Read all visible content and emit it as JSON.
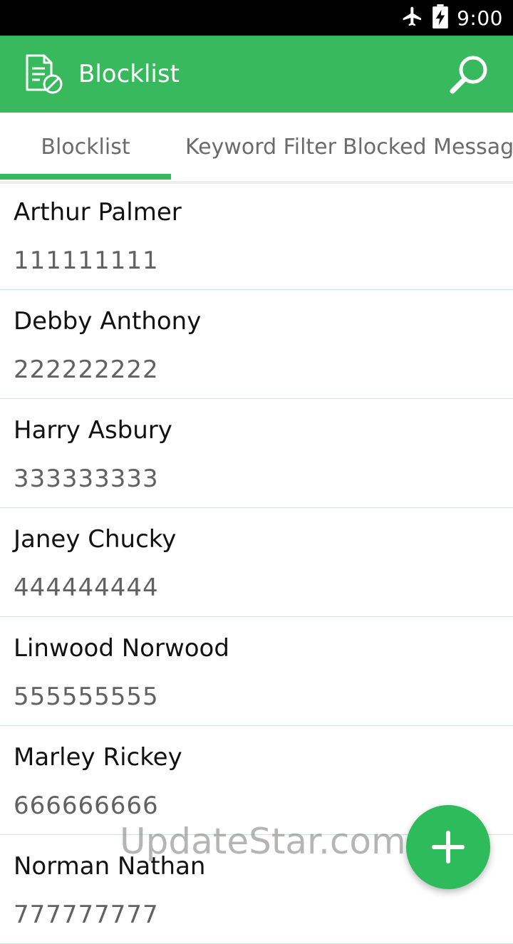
{
  "status_bar": {
    "time": "9:00",
    "icons": [
      "airplane-mode-icon",
      "battery-charging-icon"
    ]
  },
  "app_bar": {
    "title": "Blocklist",
    "icon": "blocklist-document-icon",
    "search_icon": "search-icon",
    "color": "#39b95d"
  },
  "tabs": [
    {
      "label": "Blocklist",
      "selected": true
    },
    {
      "label": "Keyword Filter",
      "selected": false
    },
    {
      "label": "Blocked Messages",
      "selected": false
    }
  ],
  "list": {
    "items": [
      {
        "name": "Arthur Palmer",
        "number": "111111111"
      },
      {
        "name": "Debby Anthony",
        "number": "222222222"
      },
      {
        "name": "Harry Asbury",
        "number": "333333333"
      },
      {
        "name": "Janey Chucky",
        "number": "444444444"
      },
      {
        "name": "Linwood Norwood",
        "number": "555555555"
      },
      {
        "name": "Marley Rickey",
        "number": "666666666"
      },
      {
        "name": "Norman Nathan",
        "number": "777777777"
      }
    ]
  },
  "fab": {
    "icon": "plus-icon",
    "color": "#2dbb5c"
  },
  "watermark": "UpdateStar.com"
}
